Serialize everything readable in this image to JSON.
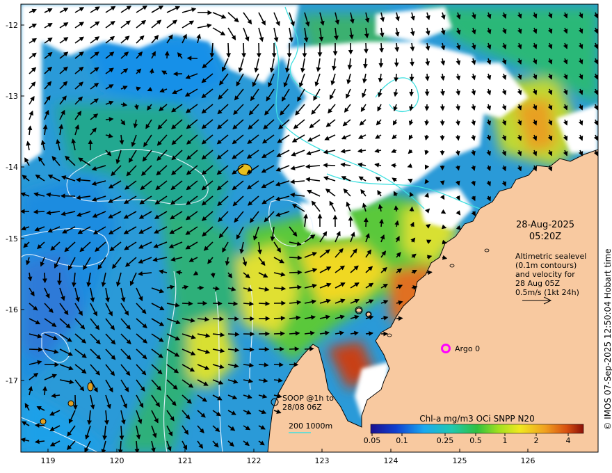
{
  "map": {
    "y_ticks": [
      "-12",
      "-13",
      "-14",
      "-15",
      "-16",
      "-17"
    ],
    "x_ticks": [
      "119",
      "120",
      "121",
      "122",
      "123",
      "124",
      "125",
      "126"
    ],
    "date": "28-Aug-2025",
    "time": "05:20Z",
    "legend_lines": [
      "Altimetric sealevel",
      "(0.1m contours)",
      "and velocity for",
      "28 Aug 05Z",
      "0.5m/s (1kt 24h)"
    ],
    "argo_label": "Argo 0",
    "soop_lines": [
      "SOOP @1h to",
      "28/08 06Z"
    ],
    "bathymetry_label": "200  1000m",
    "colorbar": {
      "title": "Chl-a mg/m3 OCi SNPP N20",
      "ticks": [
        "0.05",
        "0.1",
        "0.25",
        "0.5",
        "1",
        "2",
        "4"
      ]
    },
    "credit": "© IMOS 07-Sep-2025 12:50:04 Hobart time",
    "colors": {
      "land": "#f8c9a0",
      "cloud": "#ffffff",
      "low_chl": "#2a7bd8",
      "mid_chl": "#23b08a",
      "high_chl": "#e8e420",
      "very_high_chl": "#c0301a",
      "argo": "#ff00ff",
      "contour": "#e8f4ff",
      "bathymetry": "#40e0e0"
    }
  }
}
